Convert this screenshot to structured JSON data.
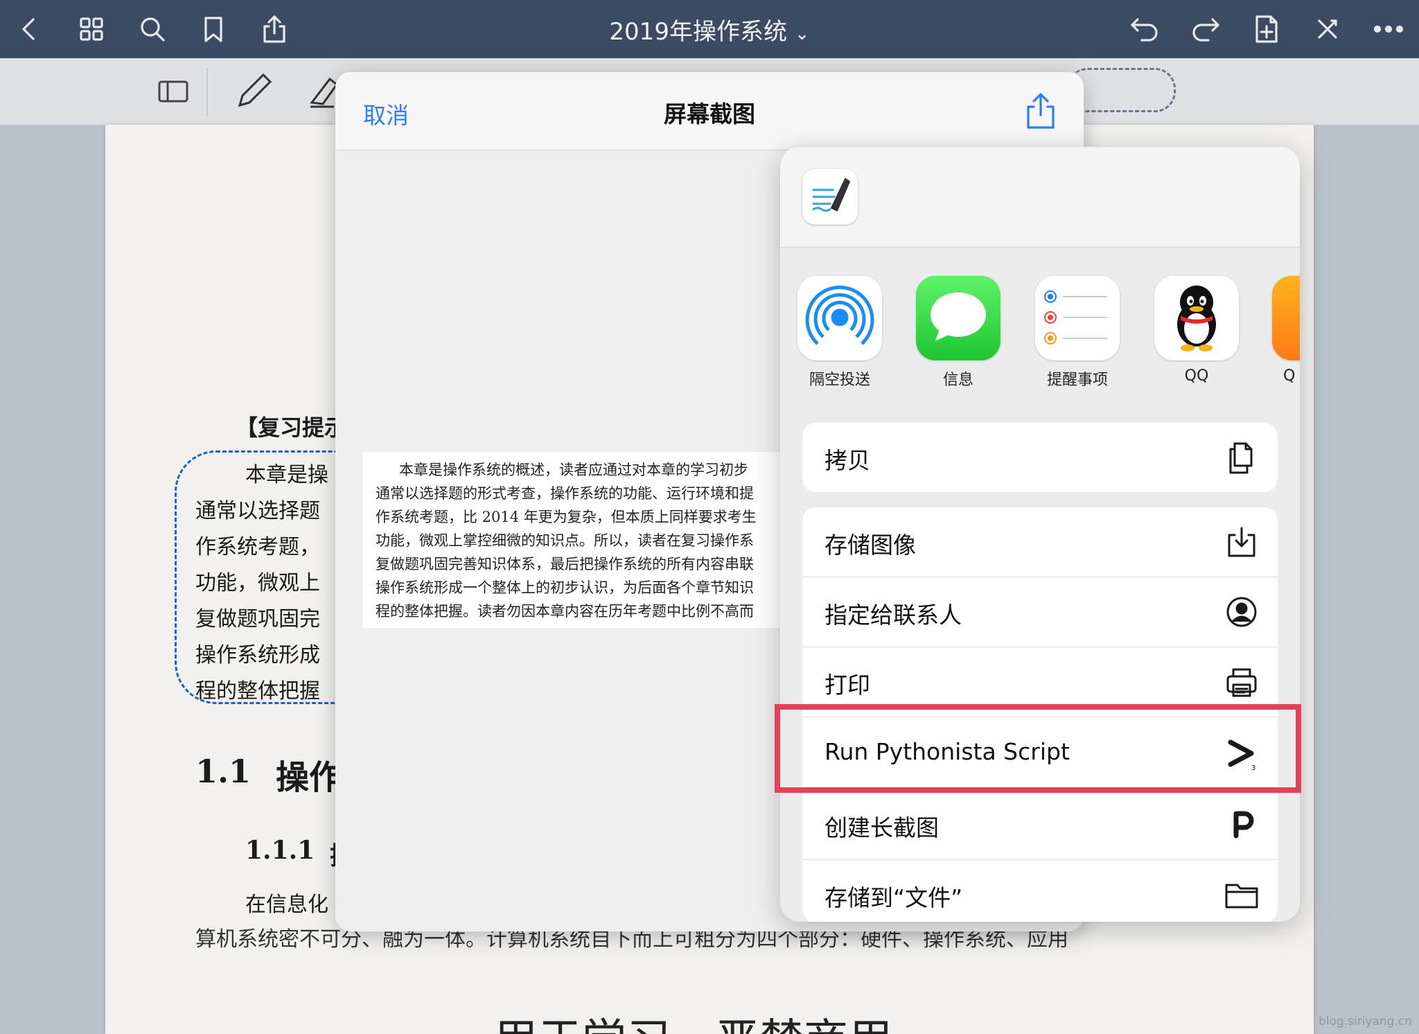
{
  "topbar": {
    "title": "2019年操作系统",
    "title_chevron": "⌄",
    "left_icons": [
      "back-icon",
      "grid-icon",
      "search-icon",
      "bookmark-icon",
      "export-icon"
    ],
    "right_icons": [
      "undo-icon",
      "redo-icon",
      "add-page-icon",
      "close-toolbar-icon",
      "more-icon"
    ],
    "bar_color": "#3c4a63"
  },
  "page": {
    "review_heading": "【复习提示",
    "para_lines": [
      "本章是操",
      "通常以选择题",
      "作系统考题，",
      "功能，微观上",
      "复做题巩固完",
      "操作系统形成",
      "程的整体把握"
    ],
    "section_num": "1.1",
    "section_title": "操作",
    "subsection_num": "1.1.1",
    "subsection_char": "操",
    "body_line1": "在信息化",
    "body_line2": "算机系统密不可分、融为一体。计算机系统自下而上可粗分为四个部分：硬件、操作系统、应用",
    "footer_text": "用于学习，严禁商用"
  },
  "modal": {
    "cancel": "取消",
    "title": "屏幕截图",
    "snippet_lines": [
      "本章是操作系统的概述，读者应通过对本章的学习初步",
      "通常以选择题的形式考查，操作系统的功能、运行环境和提",
      "作系统考题，比 2014 年更为复杂，但本质上同样要求考生",
      "功能，微观上掌控细微的知识点。所以，读者在复习操作系",
      "复做题巩固完善知识体系，最后把操作系统的所有内容串联",
      "操作系统形成一个整体上的初步认识，为后面各个章节知识",
      "程的整体把握。读者勿因本章内容在历年考题中比例不高而"
    ],
    "accent": "#2d7cf6"
  },
  "sheet": {
    "apps": [
      {
        "label": "隔空投送",
        "icon": "airdrop-icon"
      },
      {
        "label": "信息",
        "icon": "messages-icon"
      },
      {
        "label": "提醒事项",
        "icon": "reminders-icon"
      },
      {
        "label": "QQ",
        "icon": "qq-icon"
      },
      {
        "label": "Q",
        "icon": "partial-app-icon"
      }
    ],
    "actions_group1": [
      {
        "label": "拷贝",
        "icon": "copy-icon"
      }
    ],
    "actions_group2": [
      {
        "label": "存储图像",
        "icon": "save-image-icon"
      },
      {
        "label": "指定给联系人",
        "icon": "contact-icon"
      },
      {
        "label": "打印",
        "icon": "print-icon"
      },
      {
        "label": "Run Pythonista Script",
        "icon": "pythonista-icon"
      },
      {
        "label": "创建长截图",
        "icon": "picsew-icon"
      },
      {
        "label": "存储到“文件”",
        "icon": "folder-icon"
      }
    ],
    "highlight_color": "#e3435a"
  },
  "watermark": "blog.siriyang.cn"
}
